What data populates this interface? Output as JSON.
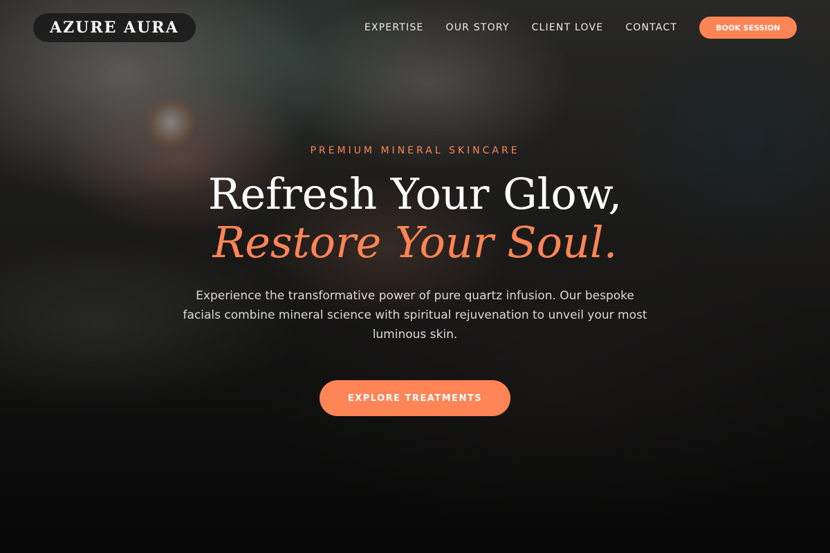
{
  "brand": {
    "name": "AZURE AURA"
  },
  "nav": {
    "links": [
      {
        "label": "EXPERTISE"
      },
      {
        "label": "OUR STORY"
      },
      {
        "label": "CLIENT LOVE"
      },
      {
        "label": "CONTACT"
      }
    ],
    "book_label": "BOOK SESSION"
  },
  "hero": {
    "eyebrow": "PREMIUM MINERAL SKINCARE",
    "headline_line1": "Refresh Your Glow,",
    "headline_line2": "Restore Your Soul.",
    "subtext": "Experience the transformative power of pure quartz infusion. Our bespoke facials combine mineral science with spiritual rejuvenation to unveil your most luminous skin.",
    "cta_label": "EXPLORE TREATMENTS"
  },
  "colors": {
    "accent": "#ff8456",
    "logo_bg": "#191919",
    "text_light": "#ffffff"
  }
}
